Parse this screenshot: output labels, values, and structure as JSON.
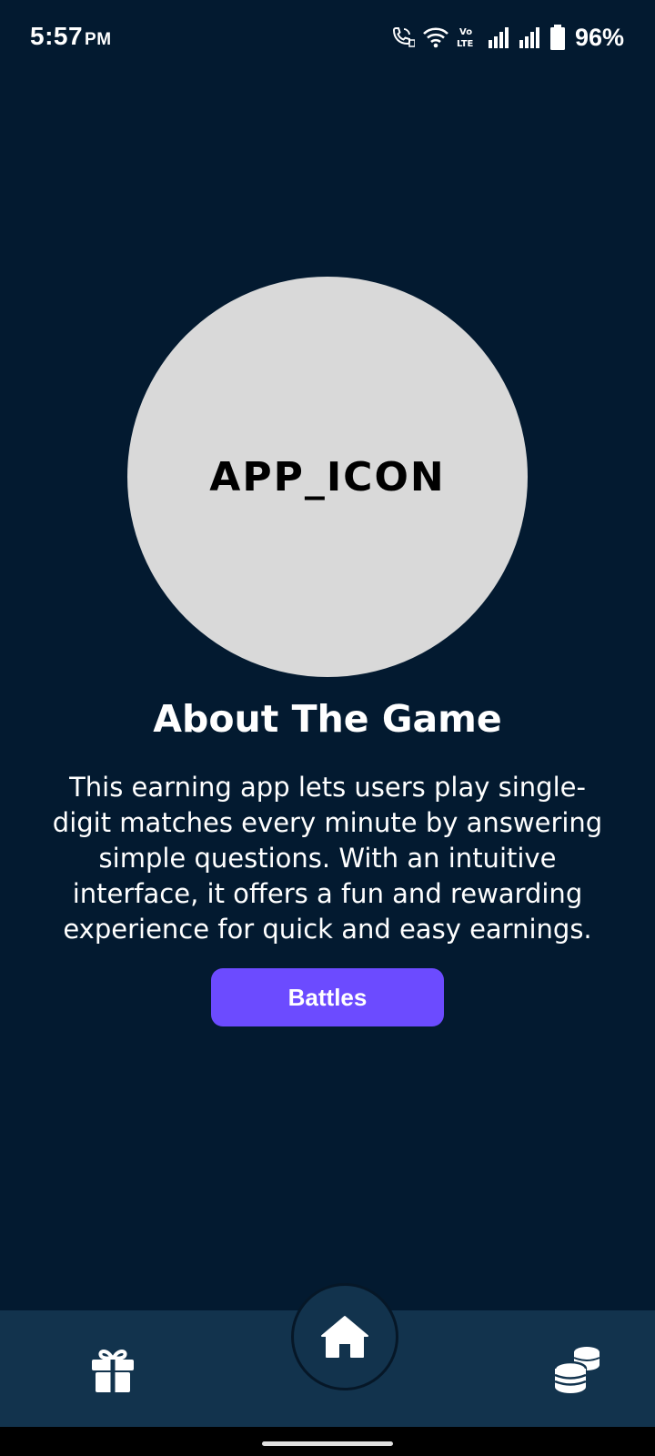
{
  "status_bar": {
    "time": "5:57",
    "ampm": "PM",
    "battery_percent": "96%",
    "icons": [
      "wifi-calling-icon",
      "wifi-icon",
      "volte-icon",
      "signal-icon",
      "signal-icon",
      "battery-icon"
    ]
  },
  "app_icon": {
    "label": "APP_ICON",
    "color": "#d9d9d9"
  },
  "about": {
    "title": "About The Game",
    "description": "This earning app lets users play single-digit matches every minute by answering simple questions. With an intuitive interface, it offers a fun and rewarding experience for quick and easy earnings."
  },
  "actions": {
    "battles_label": "Battles",
    "accent": "#6c4bff"
  },
  "bottom_nav": {
    "items": [
      {
        "icon": "gift-icon"
      },
      {
        "icon": "home-icon"
      },
      {
        "icon": "coins-icon"
      }
    ],
    "background": "#12334d"
  },
  "colors": {
    "background": "#031a30"
  }
}
